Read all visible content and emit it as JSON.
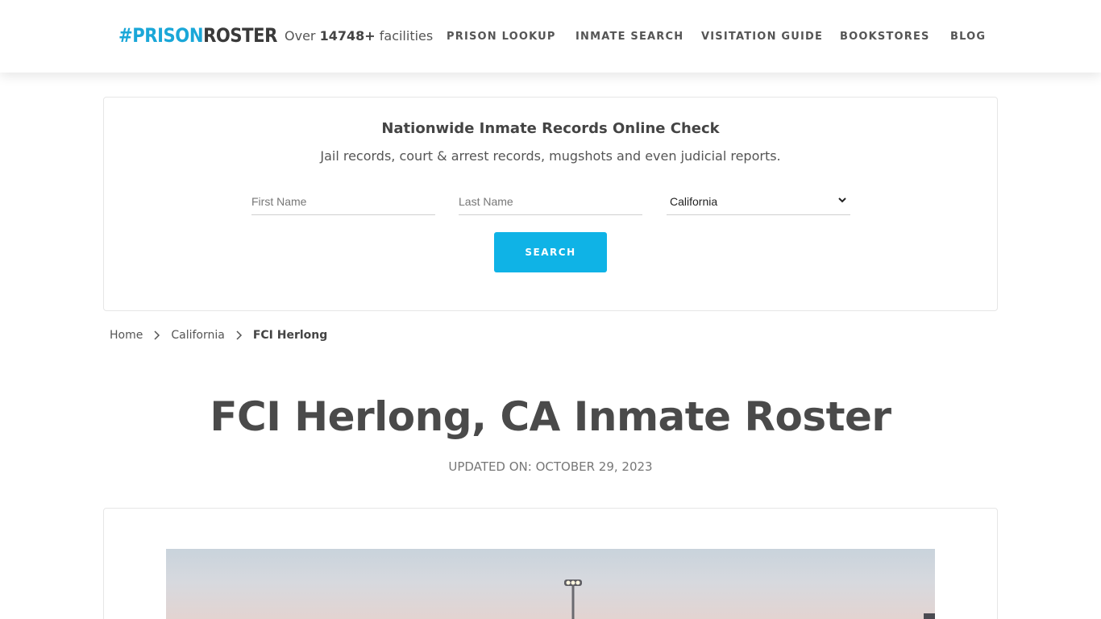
{
  "header": {
    "logo": {
      "hash": "#",
      "prison": "PRISON",
      "roster": "ROSTER"
    },
    "facilities": {
      "prefix": "Over",
      "count": "14748+",
      "suffix": "facilities"
    },
    "nav": [
      {
        "label": "PRISON LOOKUP"
      },
      {
        "label": "INMATE SEARCH"
      },
      {
        "label": "VISITATION GUIDE"
      },
      {
        "label": "BOOKSTORES"
      },
      {
        "label": "BLOG"
      }
    ]
  },
  "search": {
    "title": "Nationwide Inmate Records Online Check",
    "subtitle": "Jail records, court & arrest records, mugshots and even judicial reports.",
    "first_name_placeholder": "First Name",
    "last_name_placeholder": "Last Name",
    "state_selected": "California",
    "button_label": "SEARCH"
  },
  "breadcrumb": {
    "home": "Home",
    "state": "California",
    "current": "FCI Herlong"
  },
  "page": {
    "title": "FCI Herlong, CA Inmate Roster",
    "updated": "UPDATED ON: OCTOBER 29, 2023"
  },
  "colors": {
    "accent": "#0fb3e6",
    "logo_blue": "#1aa7d8",
    "text": "#4a4a4a"
  },
  "icons": {
    "breadcrumb_separator": "chevron-right-icon",
    "select_arrow": "chevron-down-icon"
  }
}
